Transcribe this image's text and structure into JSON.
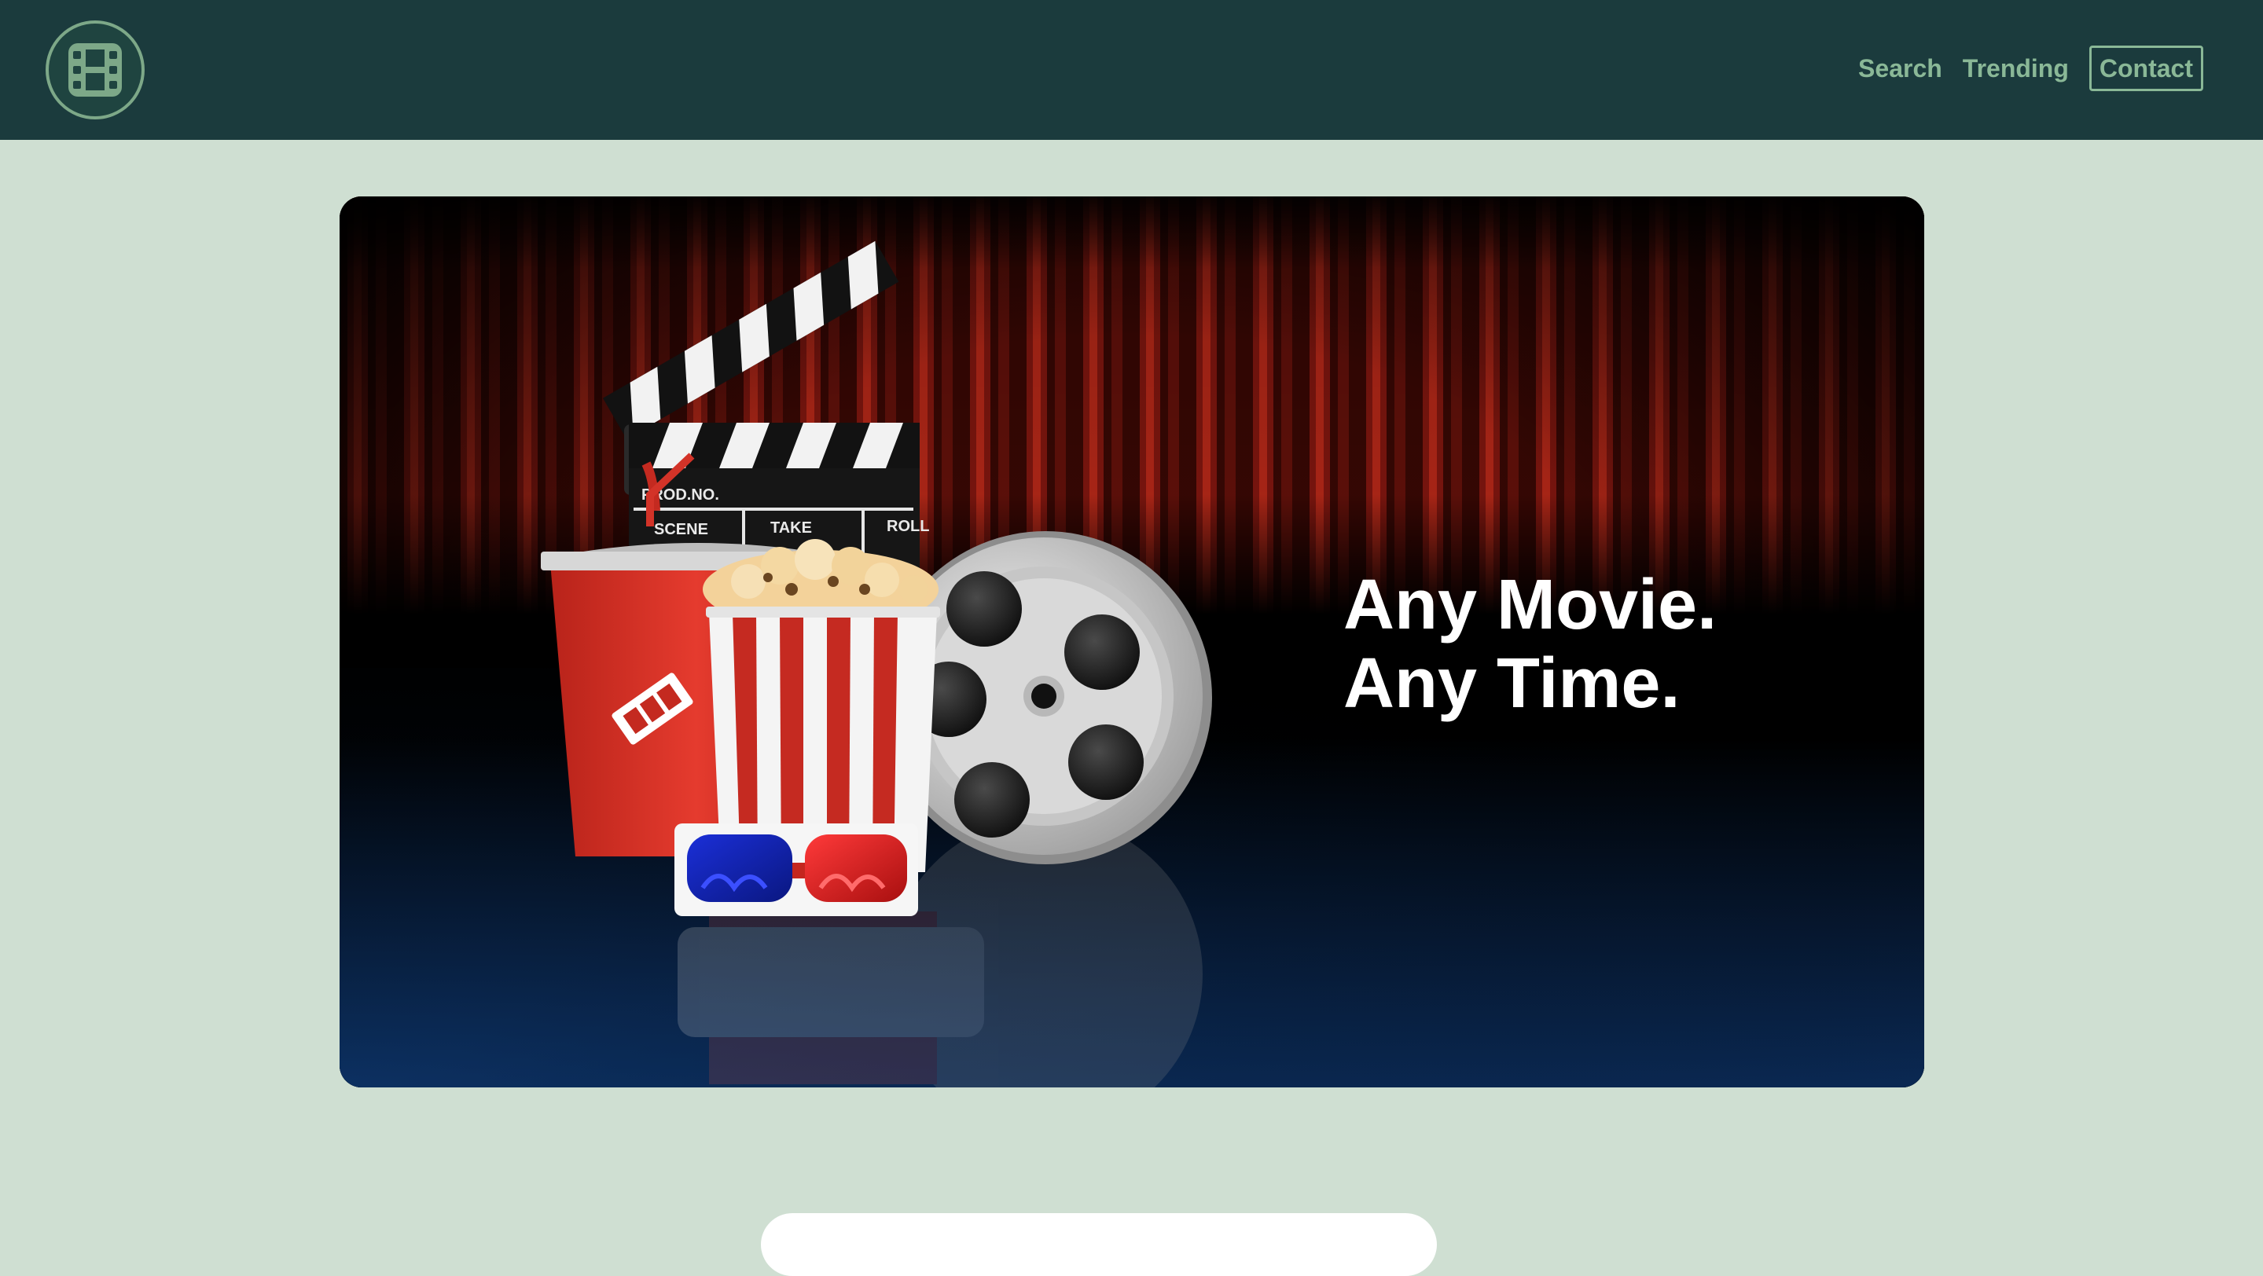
{
  "navbar": {
    "logo_icon": "film-icon",
    "links": [
      {
        "label": "Search"
      },
      {
        "label": "Trending"
      },
      {
        "label": "Contact"
      }
    ]
  },
  "hero": {
    "line1": "Any Movie.",
    "line2": "Any Time.",
    "clapper": {
      "prod_label": "PROD.NO.",
      "scene_label": "SCENE",
      "take_label": "TAKE",
      "roll_label": "ROLL"
    }
  },
  "colors": {
    "navbar_bg": "#1b3b3d",
    "page_bg": "#cfdfd2",
    "accent": "#8ab897",
    "curtain": "#9b1a10"
  }
}
